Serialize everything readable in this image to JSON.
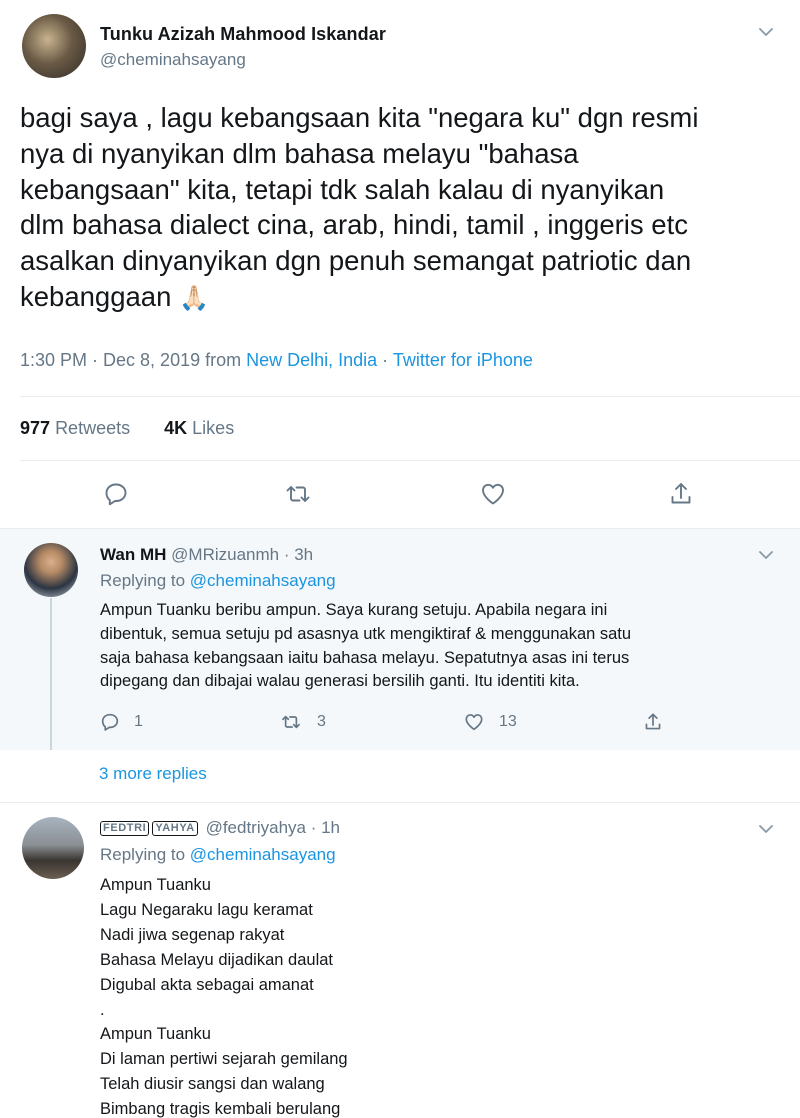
{
  "main_tweet": {
    "author_name": "Tunku Azizah Mahmood Iskandar",
    "author_handle": "@cheminahsayang",
    "text_lines": [
      "bagi saya , lagu kebangsaan kita \"negara ku\" dgn resmi",
      "nya di nyanyikan dlm bahasa melayu \"bahasa",
      "kebangsaan\" kita, tetapi tdk salah kalau di nyanyikan",
      "dlm bahasa dialect cina, arab, hindi, tamil , inggeris etc",
      "asalkan dinyanyikan dgn penuh semangat patriotic dan",
      "kebanggaan"
    ],
    "emoji": "🙏🏻",
    "time": "1:30 PM · Dec 8, 2019 from ",
    "location": "New Delhi, India",
    "separator": " · ",
    "source": "Twitter for iPhone",
    "retweets_count": "977",
    "retweets_label": "Retweets",
    "likes_count": "4K",
    "likes_label": "Likes",
    "actions": [
      "reply-icon",
      "retweet-icon",
      "like-icon",
      "share-icon"
    ]
  },
  "reply_1": {
    "author_name": "Wan MH",
    "author_handle": "@MRizuanmh",
    "time": " · 3h",
    "replying_prefix": "Replying to ",
    "replying_to": "@cheminahsayang",
    "text_lines": [
      "Ampun Tuanku beribu ampun. Saya kurang setuju. Apabila negara ini",
      "dibentuk, semua setuju pd asasnya utk mengiktiraf & menggunakan satu",
      "saja bahasa kebangsaan iaitu bahasa melayu. Sepatutnya asas ini terus",
      "dipegang dan dibajai walau generasi bersilih ganti. Itu identiti kita."
    ],
    "reply_count": "1",
    "retweet_count": "3",
    "like_count": "13"
  },
  "more_replies": "3 more replies",
  "reply_2": {
    "author_name_styled": [
      "FEDTRI",
      "YAHYA"
    ],
    "author_handle": "@fedtriyahya",
    "time": " · 1h",
    "replying_prefix": "Replying to ",
    "replying_to": "@cheminahsayang",
    "text_lines": [
      "Ampun Tuanku",
      "Lagu Negaraku lagu keramat",
      "Nadi jiwa segenap rakyat",
      "Bahasa Melayu dijadikan daulat",
      "Digubal akta sebagai amanat",
      ".",
      "Ampun Tuanku",
      "Di laman pertiwi sejarah gemilang",
      "Telah diusir sangsi dan walang",
      "Bimbang tragis kembali berulang"
    ]
  },
  "colors": {
    "link": "#1b95e0",
    "muted": "#657786",
    "reply_bg": "#f5f8fa",
    "divider": "#e6ecf0"
  }
}
